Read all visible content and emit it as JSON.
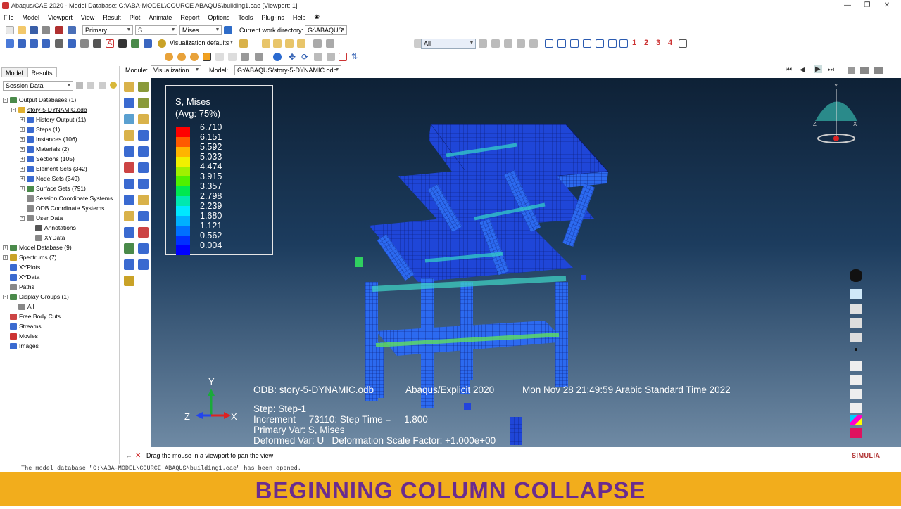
{
  "window": {
    "title": "Abaqus/CAE 2020 - Model Database: G:\\ABA-MODEL\\COURCE ABAQUS\\building1.cae [Viewport: 1]"
  },
  "menu": [
    "File",
    "Model",
    "Viewport",
    "View",
    "Result",
    "Plot",
    "Animate",
    "Report",
    "Options",
    "Tools",
    "Plug-ins",
    "Help",
    "❀"
  ],
  "toolbar": {
    "step_source": "Primary",
    "variable": "S",
    "invariant": "Mises",
    "cwd_label": "Current work directory:",
    "cwd_value": "G:\\ABAQUS",
    "filter_value": "All",
    "visualization_defaults": "Visualization defaults",
    "view_numbers": [
      "1",
      "2",
      "3",
      "4"
    ]
  },
  "context": {
    "module_label": "Module:",
    "module_value": "Visualization",
    "model_label": "Model:",
    "model_value": "G:/ABAQUS/story-5-DYNAMIC.odb"
  },
  "tree": {
    "tabs": [
      "Model",
      "Results"
    ],
    "active_tab": "Results",
    "session_combo": "Session Data",
    "items": [
      {
        "label": "Output Databases (1)",
        "depth": 0,
        "expand": "-"
      },
      {
        "label": "story-5-DYNAMIC.odb",
        "depth": 1,
        "expand": "-"
      },
      {
        "label": "History Output (11)",
        "depth": 2,
        "expand": "+"
      },
      {
        "label": "Steps (1)",
        "depth": 2,
        "expand": "+"
      },
      {
        "label": "Instances (106)",
        "depth": 2,
        "expand": "+"
      },
      {
        "label": "Materials (2)",
        "depth": 2,
        "expand": "+"
      },
      {
        "label": "Sections (105)",
        "depth": 2,
        "expand": "+"
      },
      {
        "label": "Element Sets (342)",
        "depth": 2,
        "expand": "+"
      },
      {
        "label": "Node Sets (349)",
        "depth": 2,
        "expand": "+"
      },
      {
        "label": "Surface Sets (791)",
        "depth": 2,
        "expand": "+"
      },
      {
        "label": "Session Coordinate Systems",
        "depth": 2,
        "expand": ""
      },
      {
        "label": "ODB Coordinate Systems",
        "depth": 2,
        "expand": ""
      },
      {
        "label": "User Data",
        "depth": 2,
        "expand": "-"
      },
      {
        "label": "Annotations",
        "depth": 3,
        "expand": ""
      },
      {
        "label": "XYData",
        "depth": 3,
        "expand": ""
      },
      {
        "label": "Model Database (9)",
        "depth": 0,
        "expand": "+"
      },
      {
        "label": "Spectrums (7)",
        "depth": 0,
        "expand": "+"
      },
      {
        "label": "XYPlots",
        "depth": 0,
        "expand": ""
      },
      {
        "label": "XYData",
        "depth": 0,
        "expand": ""
      },
      {
        "label": "Paths",
        "depth": 0,
        "expand": ""
      },
      {
        "label": "Display Groups (1)",
        "depth": 0,
        "expand": "-"
      },
      {
        "label": "All",
        "depth": 1,
        "expand": ""
      },
      {
        "label": "Free Body Cuts",
        "depth": 0,
        "expand": ""
      },
      {
        "label": "Streams",
        "depth": 0,
        "expand": ""
      },
      {
        "label": "Movies",
        "depth": 0,
        "expand": ""
      },
      {
        "label": "Images",
        "depth": 0,
        "expand": ""
      }
    ]
  },
  "legend": {
    "title1": "S, Mises",
    "title2": "(Avg: 75%)",
    "values": [
      "6.710",
      "6.151",
      "5.592",
      "5.033",
      "4.474",
      "3.915",
      "3.357",
      "2.798",
      "2.239",
      "1.680",
      "1.121",
      "0.562",
      "0.004"
    ],
    "colors": [
      "#ff0000",
      "#ff5a00",
      "#ffb400",
      "#f0f000",
      "#a0f000",
      "#50f000",
      "#00e850",
      "#00e8b0",
      "#00e8ff",
      "#00b0ff",
      "#0070ff",
      "#0030ff",
      "#0000ff"
    ]
  },
  "viewport_info": {
    "odb": "ODB: story-5-DYNAMIC.odb",
    "solver": "Abaqus/Explicit 2020",
    "date": "Mon Nov 28 21:49:59 Arabic Standard Time 2022",
    "step": "Step: Step-1",
    "increment": "Increment     73110: Step Time =     1.800",
    "primary_var": "Primary Var: S, Mises",
    "deformed_var": "Deformed Var: U   Deformation Scale Factor: +1.000e+00"
  },
  "triad": {
    "x": "X",
    "y": "Y",
    "z": "Z"
  },
  "status": {
    "prompt": "Drag the mouse in a viewport to pan the view"
  },
  "message": "The model database \"G:\\ABA-MODEL\\COURCE ABAQUS\\building1.cae\" has been opened.",
  "brand": "SIMULIA",
  "banner": "BEGINNING COLUMN COLLAPSE"
}
